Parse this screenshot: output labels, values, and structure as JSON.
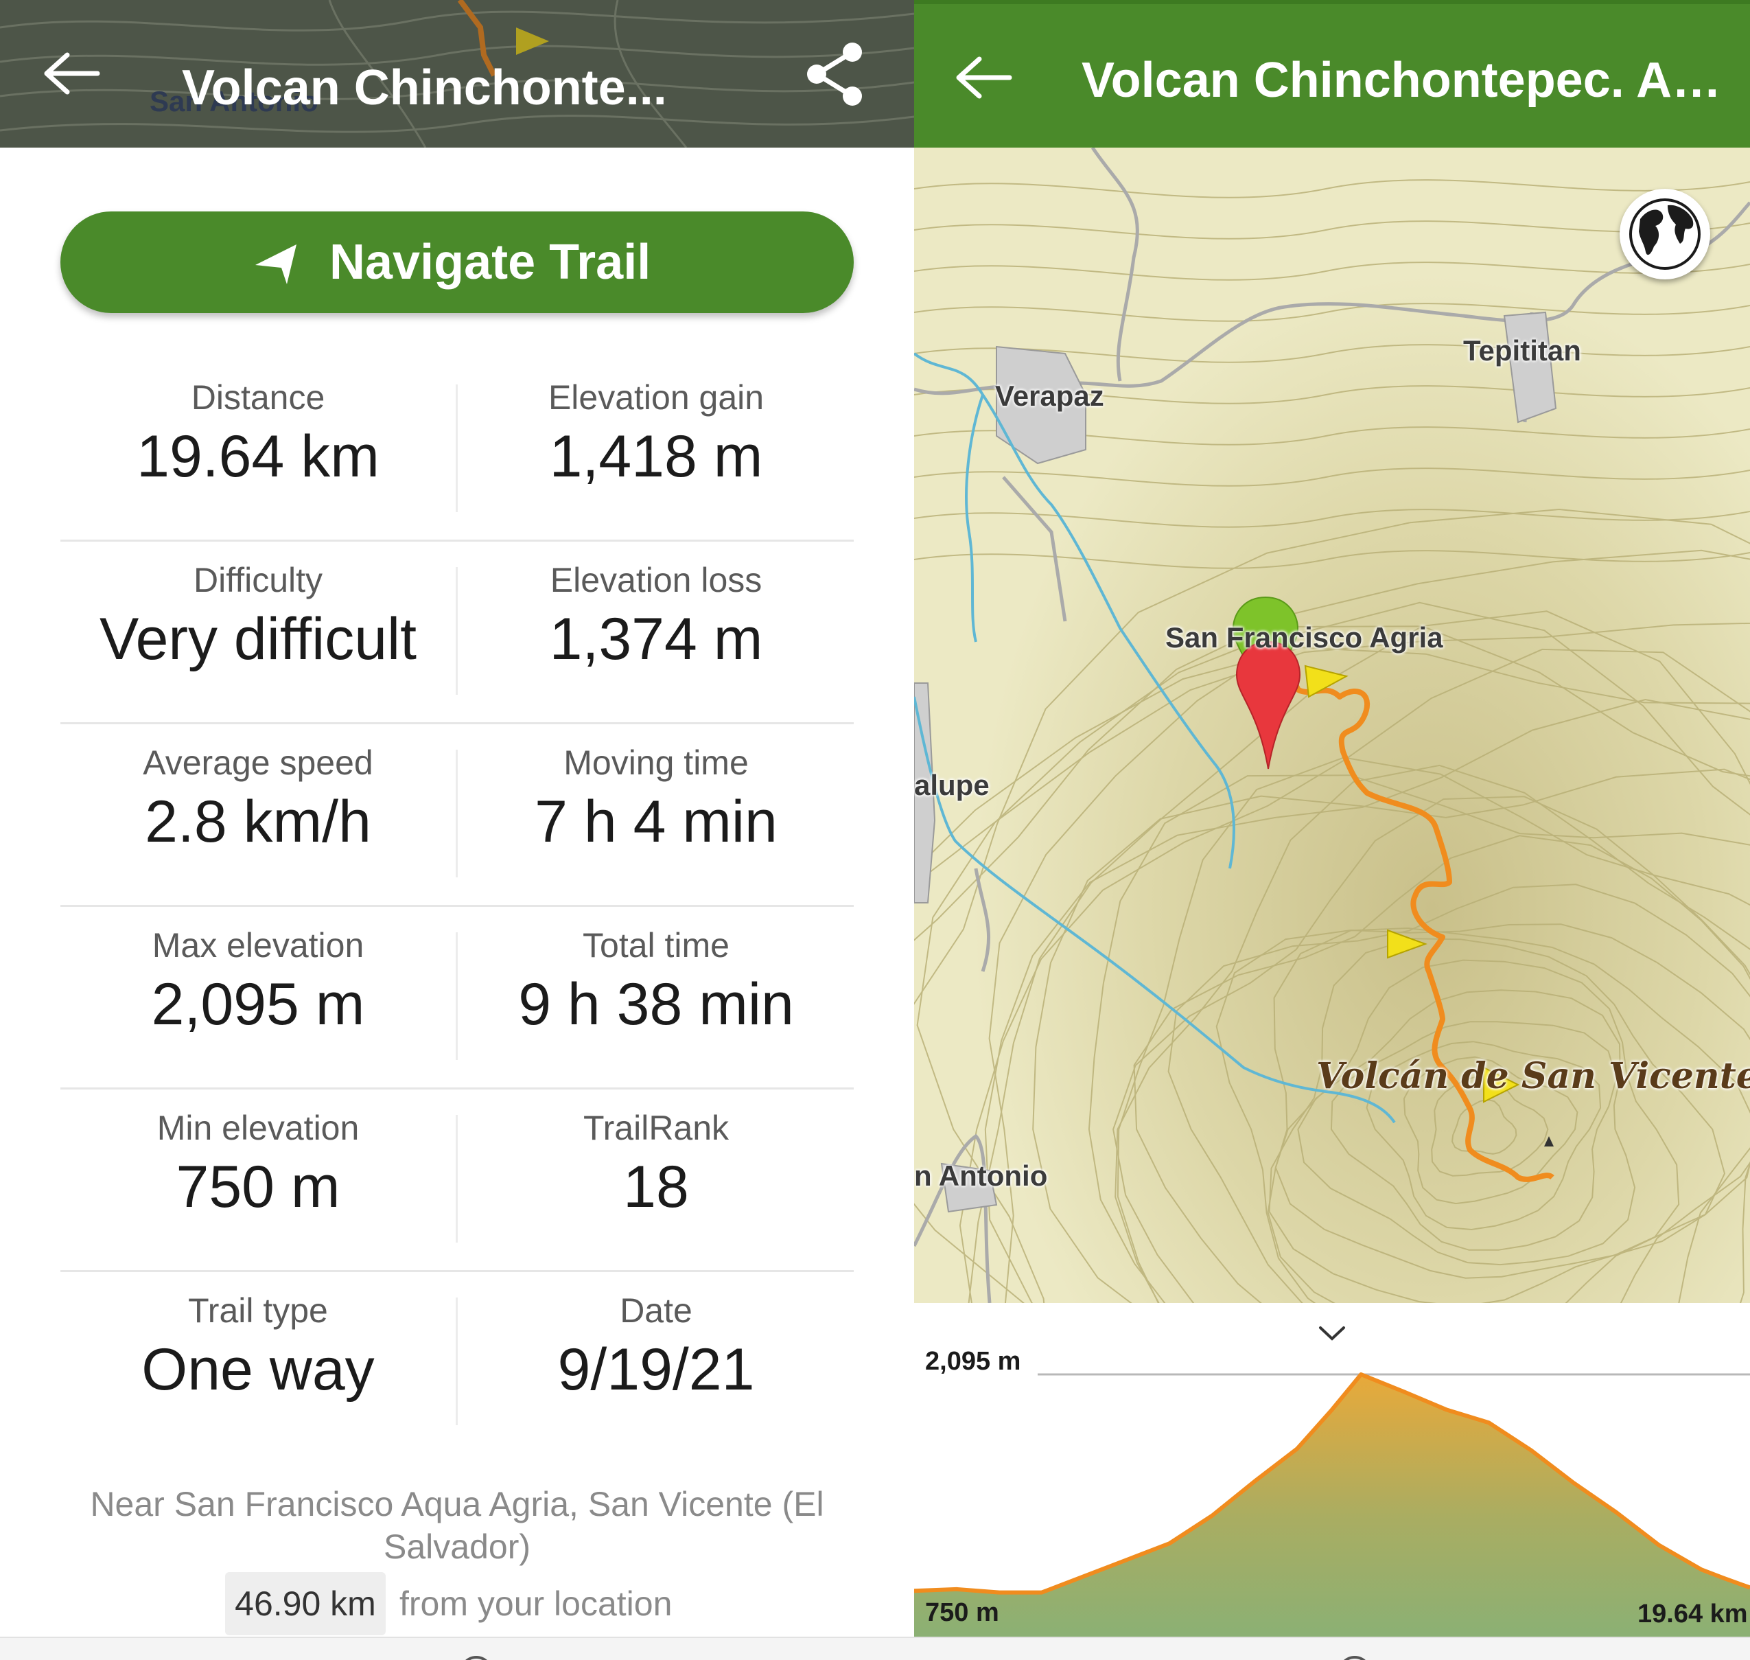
{
  "left": {
    "header_title": "Volcan Chinchonte...",
    "map_peek_label": "San Antonio",
    "navigate_label": "Navigate Trail",
    "stats": [
      {
        "left": {
          "label": "Distance",
          "value": "19.64 km"
        },
        "right": {
          "label": "Elevation gain",
          "value": "1,418 m"
        }
      },
      {
        "left": {
          "label": "Difficulty",
          "value": "Very difficult"
        },
        "right": {
          "label": "Elevation loss",
          "value": "1,374 m"
        }
      },
      {
        "left": {
          "label": "Average speed",
          "value": "2.8 km/h"
        },
        "right": {
          "label": "Moving time",
          "value": "7 h 4 min"
        }
      },
      {
        "left": {
          "label": "Max elevation",
          "value": "2,095 m"
        },
        "right": {
          "label": "Total time",
          "value": "9 h 38 min"
        }
      },
      {
        "left": {
          "label": "Min elevation",
          "value": "750 m"
        },
        "right": {
          "label": "TrailRank",
          "value": "18"
        }
      },
      {
        "left": {
          "label": "Trail type",
          "value": "One way"
        },
        "right": {
          "label": "Date",
          "value": "9/19/21"
        }
      }
    ],
    "location_text": "Near San Francisco Aqua Agria, San Vicente (El Salvador)",
    "distance_badge": "46.90 km",
    "distance_suffix": "from your location"
  },
  "right": {
    "header_title": "Volcan Chinchontepec. Agu...",
    "map_labels": {
      "verapaz": "Verapaz",
      "tepititan": "Tepititan",
      "san_francisco": "San Francisco Agria",
      "guadalupe": "alupe",
      "san_antonio": "n Antonio",
      "volcano": "Volcán de San Vicente"
    },
    "colors": {
      "header": "#4a8a2a",
      "trail": "#f08c1e",
      "map": "#ece9c4"
    },
    "profile": {
      "max_label": "2,095 m",
      "min_label": "750 m",
      "distance_label": "19.64 km"
    }
  },
  "chart_data": {
    "type": "area",
    "x_unit": "km",
    "y_unit": "m",
    "xlim": [
      0,
      19.64
    ],
    "ylim": [
      750,
      2095
    ],
    "x": [
      0,
      1.0,
      2.0,
      3.0,
      4.0,
      5.0,
      6.0,
      7.0,
      8.0,
      9.0,
      9.82,
      10.5,
      11.5,
      12.5,
      13.5,
      14.5,
      15.5,
      16.5,
      17.5,
      18.5,
      19.0,
      19.64
    ],
    "y": [
      770,
      780,
      760,
      760,
      860,
      960,
      1060,
      1230,
      1440,
      1640,
      1880,
      2095,
      1990,
      1880,
      1800,
      1630,
      1430,
      1250,
      1050,
      900,
      850,
      790
    ]
  }
}
